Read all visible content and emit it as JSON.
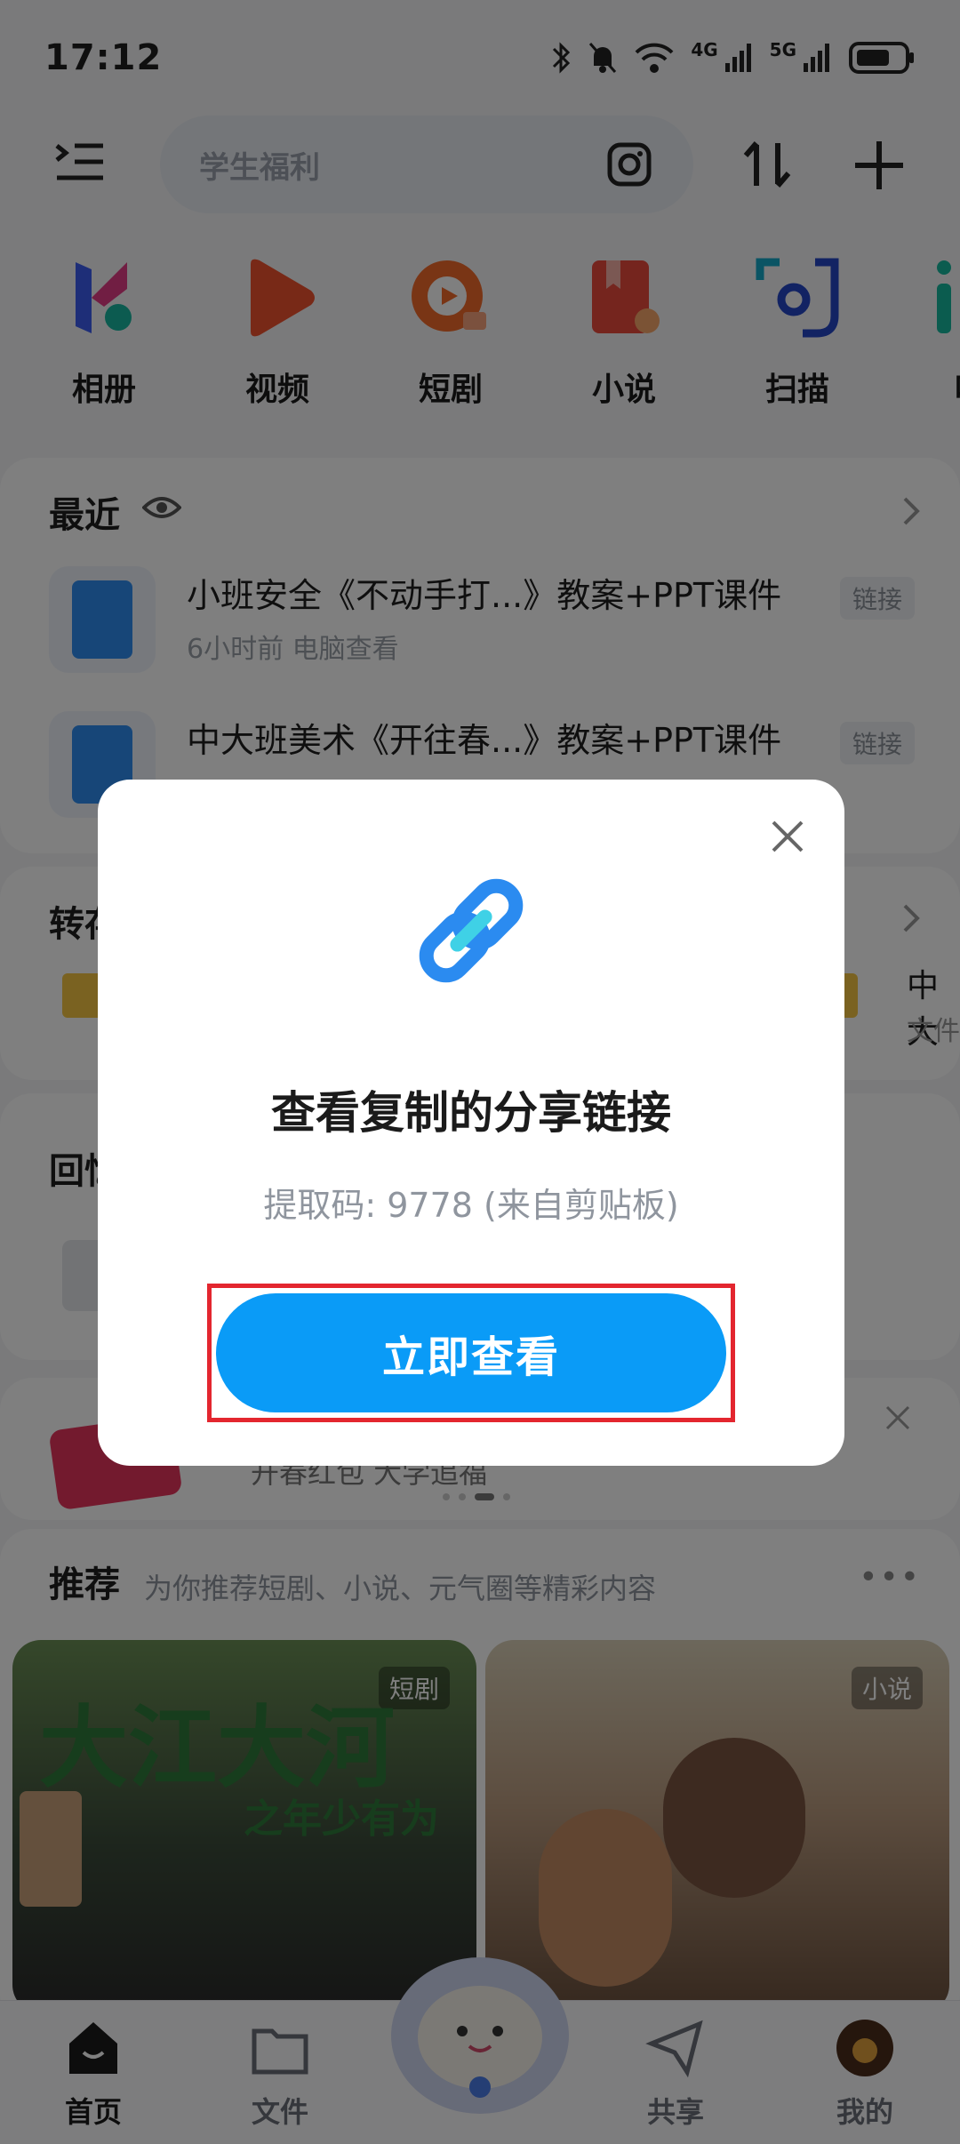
{
  "status_bar": {
    "time": "17:12",
    "net1": "4G",
    "net2": "5G"
  },
  "search": {
    "placeholder": "学生福利"
  },
  "apps": [
    {
      "label": "相册",
      "icon": "photo-album-icon"
    },
    {
      "label": "视频",
      "icon": "video-play-icon"
    },
    {
      "label": "短剧",
      "icon": "short-drama-icon"
    },
    {
      "label": "小说",
      "icon": "novel-book-icon"
    },
    {
      "label": "扫描",
      "icon": "scan-icon"
    },
    {
      "label": "听",
      "icon": "listen-icon"
    }
  ],
  "recent": {
    "title": "最近",
    "items": [
      {
        "name": "小班安全《不动手打...》教案+PPT课件",
        "meta": "6小时前  电脑查看",
        "tag": "链接"
      },
      {
        "name": "中大班美术《开往春...》教案+PPT课件",
        "meta": "",
        "tag": "链接"
      }
    ]
  },
  "transfer": {
    "title": "转存",
    "right_text": "中大",
    "right_meta": "文件"
  },
  "memories": {
    "title": "回忆"
  },
  "banner": {
    "text": "开春红包 大学追福"
  },
  "recommend": {
    "title": "推荐",
    "subtitle": "为你推荐短剧、小说、元气圈等精彩内容",
    "cards": [
      {
        "tag": "短剧",
        "title": "大江大河",
        "subtitle": "之年少有为"
      },
      {
        "tag": "小说"
      }
    ]
  },
  "bottom_nav": [
    {
      "label": "首页",
      "icon": "home-icon",
      "active": true
    },
    {
      "label": "文件",
      "icon": "folder-icon",
      "active": false
    },
    {
      "label": "共享",
      "icon": "send-icon",
      "active": false
    },
    {
      "label": "我的",
      "icon": "avatar-icon",
      "active": false
    }
  ],
  "dialog": {
    "title": "查看复制的分享链接",
    "code_text": "提取码: 9778 (来自剪贴板)",
    "button": "立即查看"
  },
  "colors": {
    "accent": "#0a9bf7",
    "highlight": "#e3262f",
    "overlay": "rgba(0,0,0,0.5)"
  }
}
